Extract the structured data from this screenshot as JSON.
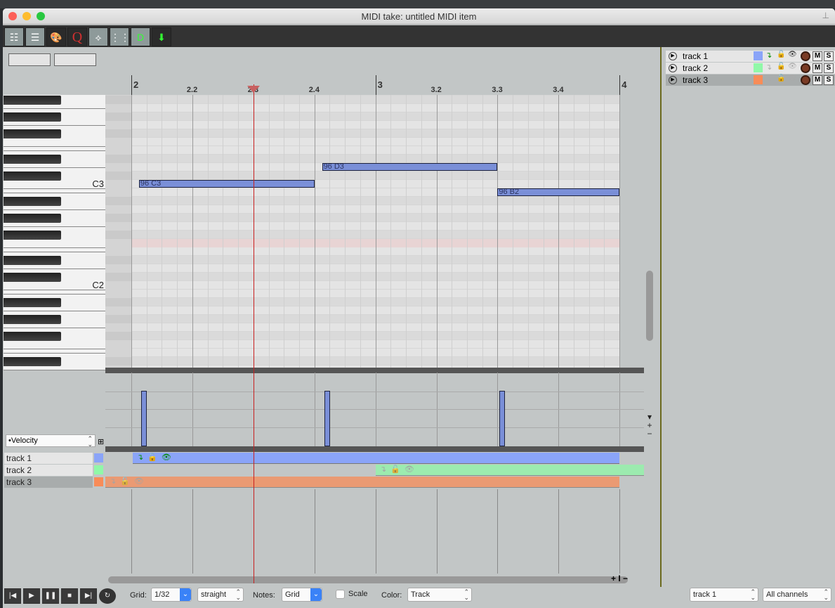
{
  "window": {
    "title": "MIDI take: untitled MIDI item"
  },
  "colors": {
    "note": "#7a8fd8",
    "track1": "#8aa4f8",
    "track2": "#90f8a8",
    "track3": "#f88c58",
    "playhead": "#c82020"
  },
  "toolbar": {
    "icons": [
      "event-list-icon",
      "note-names-icon",
      "color-palette-icon",
      "quantize-icon",
      "cc-envelope-icon",
      "grid-icon",
      "loop-magnet-icon",
      "insert-icon"
    ]
  },
  "ruler": {
    "labels": [
      {
        "t": "2",
        "beat": 0,
        "major": true
      },
      {
        "t": "2.2",
        "beat": 1
      },
      {
        "t": "2.3",
        "beat": 2
      },
      {
        "t": "2.4",
        "beat": 3
      },
      {
        "t": "3",
        "beat": 4,
        "major": true
      },
      {
        "t": "3.2",
        "beat": 5
      },
      {
        "t": "3.3",
        "beat": 6
      },
      {
        "t": "3.4",
        "beat": 7
      },
      {
        "t": "4",
        "beat": 8,
        "major": true
      }
    ]
  },
  "piano": {
    "labels": [
      {
        "t": "C3",
        "pitch": 48
      },
      {
        "t": "C2",
        "pitch": 36
      }
    ]
  },
  "notes": [
    {
      "label": "96 C3",
      "pitch": 48,
      "start": 0.125,
      "end": 3,
      "velocity": 96
    },
    {
      "label": "96 D3",
      "pitch": 50,
      "start": 3.125,
      "end": 6,
      "velocity": 96
    },
    {
      "label": "96 B2",
      "pitch": 47,
      "start": 6,
      "end": 8,
      "velocity": 96
    }
  ],
  "highlight_pitch": 41,
  "playhead_beat": 2,
  "cc_lane": {
    "selected": "•Velocity"
  },
  "tracks": [
    {
      "name": "track 1",
      "color": "#8aa4f8"
    },
    {
      "name": "track 2",
      "color": "#90f8a8"
    },
    {
      "name": "track 3",
      "color": "#f88c58"
    }
  ],
  "right_tracks": {
    "mute": "M",
    "solo": "S"
  },
  "bottom": {
    "grid_label": "Grid:",
    "grid_value": "1/32",
    "grid_type": "straight",
    "notes_label": "Notes:",
    "notes_value": "Grid",
    "scale_label": "Scale",
    "color_label": "Color:",
    "color_value": "Track",
    "track_select": "track 1",
    "channel_select": "All channels"
  }
}
